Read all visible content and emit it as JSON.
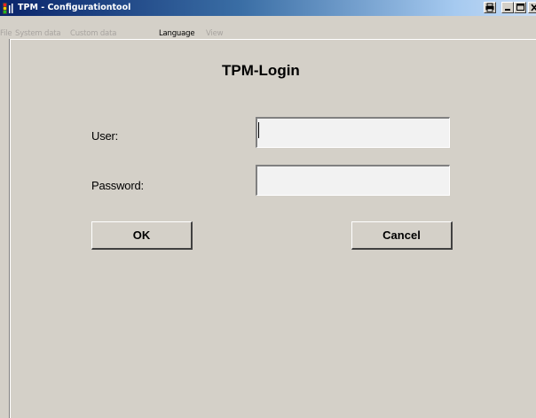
{
  "window": {
    "title": "TPM - Configurationtool"
  },
  "menu": {
    "items": [
      {
        "label": "File",
        "enabled": false
      },
      {
        "label": "System data",
        "enabled": false
      },
      {
        "label": "Custom data",
        "enabled": false
      },
      {
        "label": "Language",
        "enabled": true
      },
      {
        "label": "View",
        "enabled": false
      }
    ]
  },
  "login": {
    "title": "TPM-Login",
    "user_label": "User:",
    "user_value": "",
    "password_label": "Password:",
    "password_value": "",
    "ok_label": "OK",
    "cancel_label": "Cancel"
  },
  "icons": {
    "app": "traffic-light-icon",
    "extra": "print-icon",
    "minimize": "minimize-icon",
    "maximize": "maximize-icon",
    "close": "close-icon"
  },
  "colors": {
    "titlebar_start": "#0a246a",
    "titlebar_end": "#a6caf0",
    "window_face": "#d4d0c8",
    "disabled_text": "#a8a4a0",
    "input_bg": "#f2f2f2"
  }
}
